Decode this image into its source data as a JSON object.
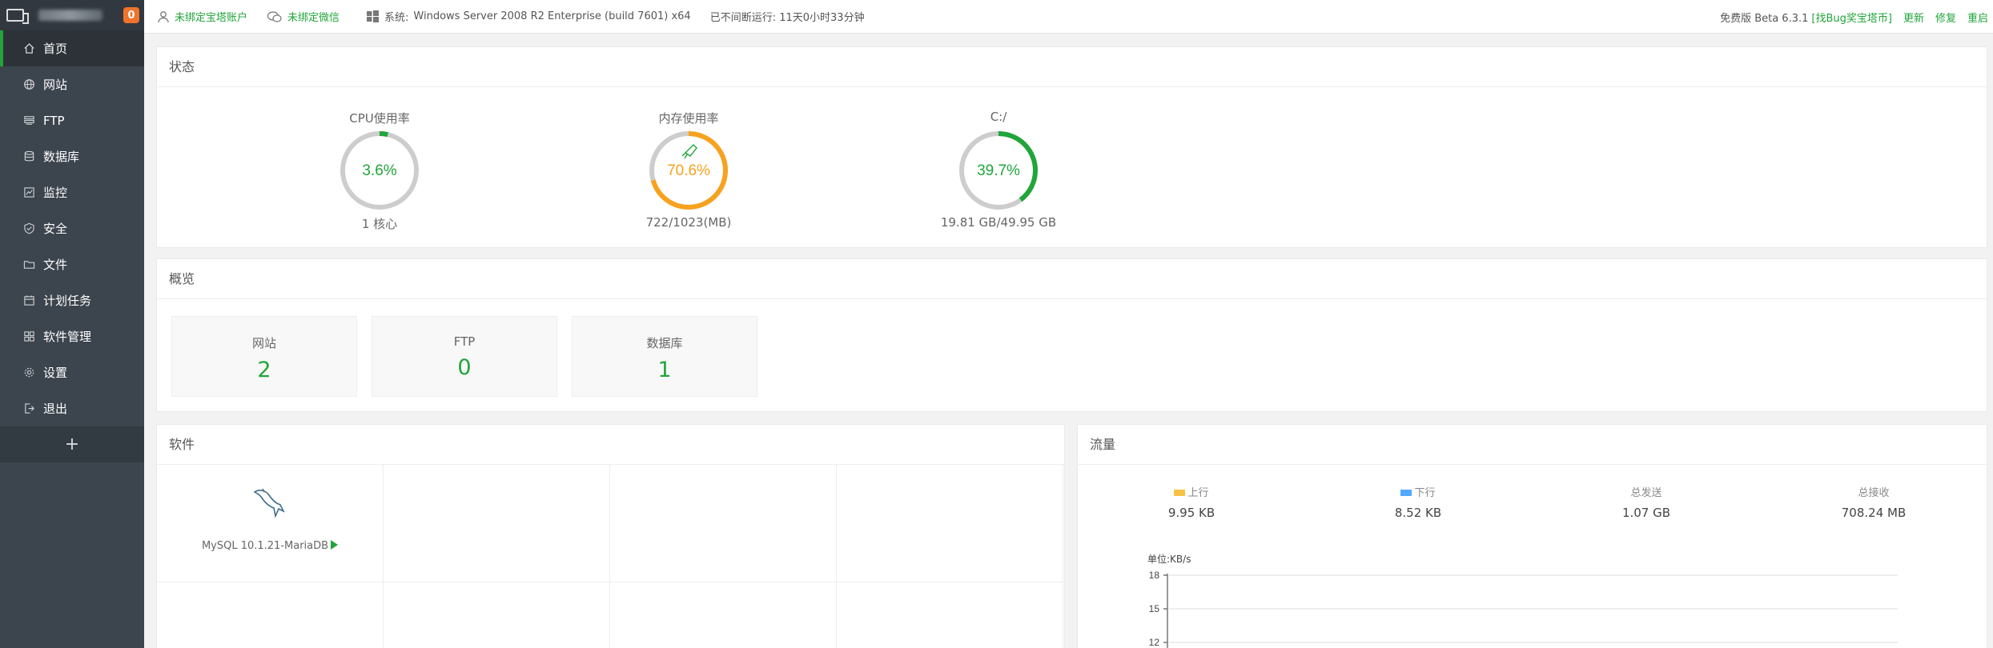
{
  "sidebar": {
    "badge": "0",
    "items": [
      {
        "label": "首页",
        "icon": "home-icon"
      },
      {
        "label": "网站",
        "icon": "globe-icon"
      },
      {
        "label": "FTP",
        "icon": "ftp-icon"
      },
      {
        "label": "数据库",
        "icon": "database-icon"
      },
      {
        "label": "监控",
        "icon": "monitor-icon"
      },
      {
        "label": "安全",
        "icon": "shield-icon"
      },
      {
        "label": "文件",
        "icon": "folder-icon"
      },
      {
        "label": "计划任务",
        "icon": "calendar-icon"
      },
      {
        "label": "软件管理",
        "icon": "apps-icon"
      },
      {
        "label": "设置",
        "icon": "gear-icon"
      },
      {
        "label": "退出",
        "icon": "logout-icon"
      }
    ],
    "add_label": "+"
  },
  "topbar": {
    "account": "未绑定宝塔账户",
    "wechat": "未绑定微信",
    "system_label": "系统:",
    "system_value": "Windows Server 2008 R2 Enterprise (build 7601) x64",
    "uptime": "已不间断运行: 11天0小时33分钟",
    "version": "免费版 Beta 6.3.1",
    "bug_link": "[找Bug奖宝塔币]",
    "update": "更新",
    "repair": "修复",
    "restart": "重启"
  },
  "status": {
    "title": "状态",
    "cpu": {
      "label": "CPU使用率",
      "percent": 3.6,
      "text": "3.6%",
      "sub": "1 核心",
      "color": "#20a53a"
    },
    "memory": {
      "label": "内存使用率",
      "percent": 70.6,
      "text": "70.6%",
      "sub": "722/1023(MB)",
      "color": "#f7a21e"
    },
    "disk": {
      "label": "C:/",
      "percent": 39.7,
      "text": "39.7%",
      "sub": "19.81 GB/49.95 GB",
      "color": "#20a53a"
    }
  },
  "overview": {
    "title": "概览",
    "cards": [
      {
        "name": "网站",
        "value": "2"
      },
      {
        "name": "FTP",
        "value": "0"
      },
      {
        "name": "数据库",
        "value": "1"
      }
    ]
  },
  "software": {
    "title": "软件",
    "items": [
      {
        "name": "MySQL 10.1.21-MariaDB",
        "icon": "mysql-dolphin-icon"
      }
    ]
  },
  "traffic": {
    "title": "流量",
    "up_label": "上行",
    "up_value": "9.95 KB",
    "up_color": "#f7c342",
    "down_label": "下行",
    "down_value": "8.52 KB",
    "down_color": "#52a9ff",
    "sent_label": "总发送",
    "sent_value": "1.07 GB",
    "recv_label": "总接收",
    "recv_value": "708.24 MB",
    "unit": "单位:KB/s",
    "yticks": [
      "18",
      "15",
      "12"
    ]
  }
}
